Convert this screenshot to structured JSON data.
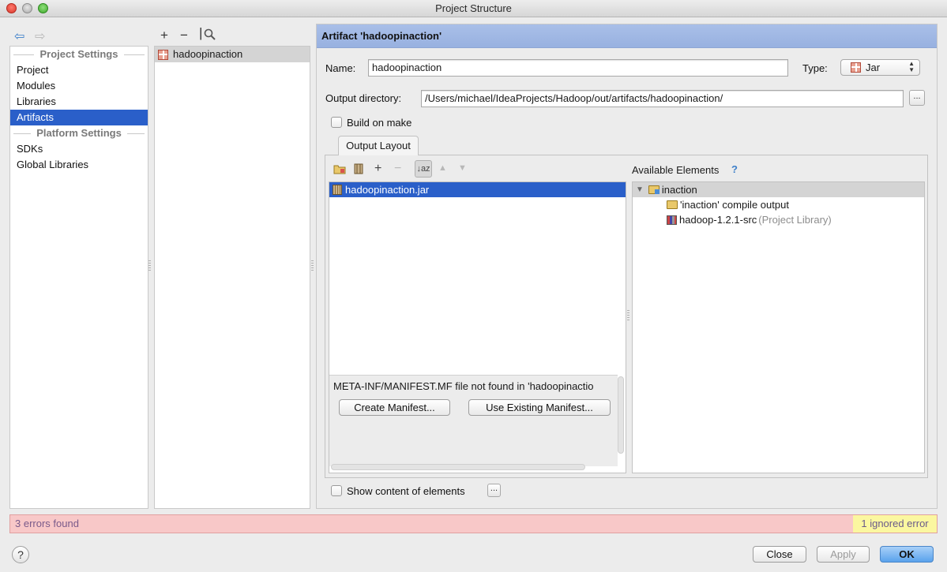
{
  "window": {
    "title": "Project Structure"
  },
  "left_nav": {
    "project_settings_header": "Project Settings",
    "project_items": [
      {
        "label": "Project"
      },
      {
        "label": "Modules"
      },
      {
        "label": "Libraries"
      },
      {
        "label": "Artifacts",
        "selected": true
      }
    ],
    "platform_settings_header": "Platform Settings",
    "platform_items": [
      {
        "label": "SDKs"
      },
      {
        "label": "Global Libraries"
      }
    ]
  },
  "middle": {
    "toolbar": {
      "add": "+",
      "remove": "−"
    },
    "artifacts": [
      {
        "label": "hadoopinaction",
        "selected": true
      }
    ]
  },
  "artifact": {
    "header": "Artifact 'hadoopinaction'",
    "name_label": "Name:",
    "name_value": "hadoopinaction",
    "type_label": "Type:",
    "type_value": "Jar",
    "output_dir_label": "Output directory:",
    "output_dir_value": "/Users/michael/IdeaProjects/Hadoop/out/artifacts/hadoopinaction/",
    "browse_label": "...",
    "build_on_make_label": "Build on make",
    "build_on_make_checked": false,
    "tab_label": "Output Layout"
  },
  "layout": {
    "root_item": "hadoopinaction.jar",
    "manifest_message": "META-INF/MANIFEST.MF file not found in 'hadoopinactio",
    "create_manifest": "Create Manifest...",
    "use_existing_manifest": "Use Existing Manifest..."
  },
  "available": {
    "label": "Available Elements",
    "help": "?",
    "root": "inaction",
    "children": [
      {
        "label": "'inaction' compile output",
        "suffix": "",
        "icon": "folder-output-icon"
      },
      {
        "label": "hadoop-1.2.1-src",
        "suffix": "(Project Library)",
        "icon": "library-icon"
      }
    ]
  },
  "show_content_label": "Show content of elements",
  "show_content_checked": false,
  "show_content_btn": "...",
  "status": {
    "errors": "3 errors found",
    "ignored": "1 ignored error",
    "error_bg": "#f8c8c8",
    "ignored_bg": "#fbf7a0"
  },
  "buttons": {
    "help": "?",
    "close": "Close",
    "apply": "Apply",
    "ok": "OK"
  },
  "colors": {
    "selection": "#2a5fc9",
    "header_bg": "#a9bfe8"
  }
}
